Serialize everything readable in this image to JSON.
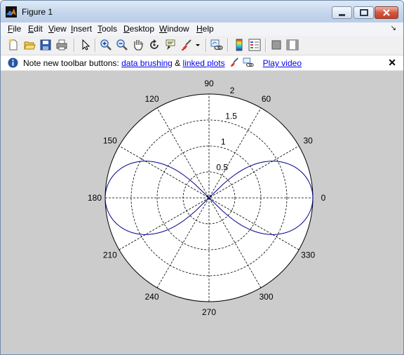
{
  "window": {
    "title": "Figure 1"
  },
  "menu": [
    {
      "pre": "",
      "u": "F",
      "post": "ile"
    },
    {
      "pre": "",
      "u": "E",
      "post": "dit"
    },
    {
      "pre": "",
      "u": "V",
      "post": "iew"
    },
    {
      "pre": "",
      "u": "I",
      "post": "nsert"
    },
    {
      "pre": "",
      "u": "T",
      "post": "ools"
    },
    {
      "pre": "",
      "u": "D",
      "post": "esktop"
    },
    {
      "pre": "",
      "u": "W",
      "post": "indow"
    },
    {
      "pre": "",
      "u": "H",
      "post": "elp"
    }
  ],
  "toolbar": {
    "icons": [
      "new-figure-icon",
      "open-file-icon",
      "save-icon",
      "print-icon",
      "pointer-icon",
      "zoom-in-icon",
      "zoom-out-icon",
      "pan-hand-icon",
      "rotate-3d-icon",
      "data-cursor-icon",
      "brush-icon",
      "brush-dropdown-icon",
      "link-plot-icon",
      "colorbar-icon",
      "legend-icon",
      "hide-plot-tools-icon",
      "show-plot-tools-icon"
    ]
  },
  "infobar": {
    "text": "Note new toolbar buttons:",
    "link_brushing": "data brushing",
    "amp": "&",
    "link_linked": "linked plots",
    "link_video": "Play video",
    "close": "✕"
  },
  "chart_data": {
    "type": "line",
    "subtype": "polar",
    "title": "",
    "angle_ticks_deg": [
      0,
      30,
      60,
      90,
      120,
      150,
      180,
      210,
      240,
      270,
      300,
      330
    ],
    "angle_labels": [
      "0",
      "30",
      "60",
      "90",
      "120",
      "150",
      "180",
      "210",
      "240",
      "270",
      "300",
      "330"
    ],
    "radial_ticks": [
      0.5,
      1,
      1.5,
      2
    ],
    "radial_labels": [
      "0.5",
      "1",
      "1.5",
      "2"
    ],
    "rlim": [
      0,
      2
    ],
    "grid": true,
    "series": [
      {
        "function": "r = 2*sqrt(|cos(2θ)|) for |θ|<=45° and 135°<=θ<=225°",
        "color": "#00008b",
        "theta_deg": [
          -45,
          -40,
          -35,
          -30,
          -25,
          -20,
          -15,
          -10,
          -5,
          0,
          5,
          10,
          15,
          20,
          25,
          30,
          35,
          40,
          45
        ],
        "r": [
          0,
          0.835,
          1.17,
          1.414,
          1.6,
          1.75,
          1.86,
          1.94,
          1.98,
          2,
          1.98,
          1.94,
          1.86,
          1.75,
          1.6,
          1.414,
          1.17,
          0.835,
          0
        ],
        "mirrored_left_lobe": true
      }
    ]
  }
}
